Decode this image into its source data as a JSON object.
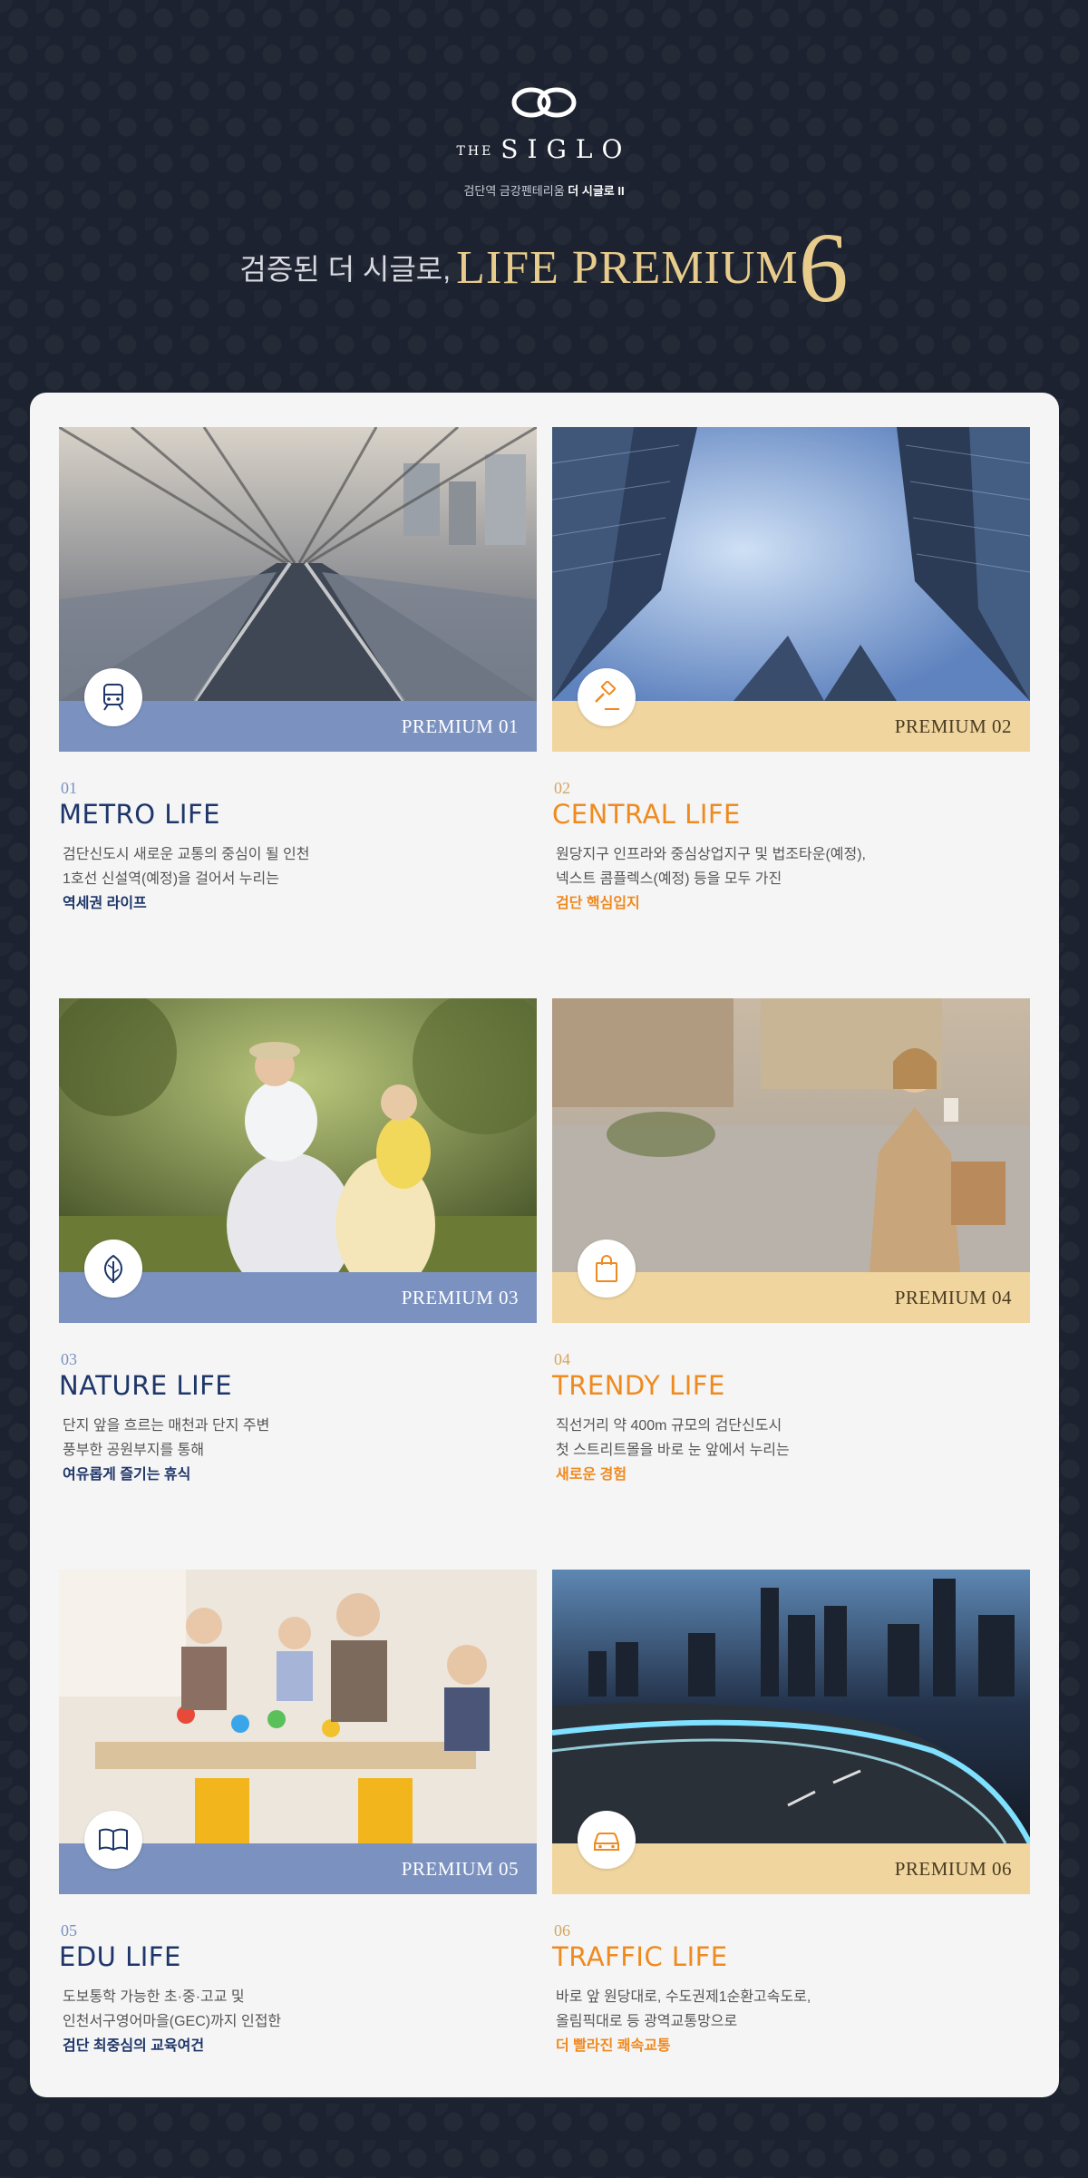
{
  "brand": {
    "the": "THE",
    "name": "SIGLO",
    "subtitle_prefix": "검단역 금강펜테리움",
    "subtitle_strong": "더 시글로 II"
  },
  "headline": {
    "korean": "검증된 더 시글로,",
    "english": "LIFE PREMIUM",
    "number": "6"
  },
  "colors": {
    "background": "#1d2230",
    "panel": "#f5f5f5",
    "blue_bar": "#7b92c1",
    "gold_bar": "#f0d59e",
    "navy_text": "#1e3669",
    "orange_text": "#ef8a1f",
    "headline_gold": "#e8cc8c"
  },
  "cards": [
    {
      "premium": "PREMIUM 01",
      "num": "01",
      "title": "METRO LIFE",
      "icon": "train-icon",
      "line1": "검단신도시 새로운 교통의 중심이 될 인천",
      "line2": "1호선 신설역(예정)을 걸어서 누리는",
      "highlight": "역세권 라이프"
    },
    {
      "premium": "PREMIUM 02",
      "num": "02",
      "title": "CENTRAL LIFE",
      "icon": "gavel-icon",
      "line1": "원당지구 인프라와 중심상업지구 및 법조타운(예정),",
      "line2": "넥스트 콤플렉스(예정) 등을 모두 가진",
      "highlight": "검단 핵심입지"
    },
    {
      "premium": "PREMIUM 03",
      "num": "03",
      "title": "NATURE LIFE",
      "icon": "leaf-icon",
      "line1": "단지 앞을 흐르는 매천과 단지 주변",
      "line2": "풍부한 공원부지를 통해",
      "highlight": "여유롭게 즐기는 휴식"
    },
    {
      "premium": "PREMIUM 04",
      "num": "04",
      "title": "TRENDY LIFE",
      "icon": "shopping-bag-icon",
      "line1": "직선거리 약 400m 규모의 검단신도시",
      "line2": "첫 스트리트몰을 바로 눈 앞에서 누리는",
      "highlight": "새로운 경험"
    },
    {
      "premium": "PREMIUM 05",
      "num": "05",
      "title": "EDU LIFE",
      "icon": "open-book-icon",
      "line1": "도보통학 가능한 초·중·고교 및",
      "line2": "인천서구영어마을(GEC)까지 인접한",
      "highlight": "검단 최중심의 교육여건"
    },
    {
      "premium": "PREMIUM 06",
      "num": "06",
      "title": "TRAFFIC LIFE",
      "icon": "car-icon",
      "line1": "바로 앞 원당대로, 수도권제1순환고속도로,",
      "line2": "올림픽대로 등 광역교통망으로",
      "highlight": "더 빨라진 쾌속교통"
    }
  ]
}
